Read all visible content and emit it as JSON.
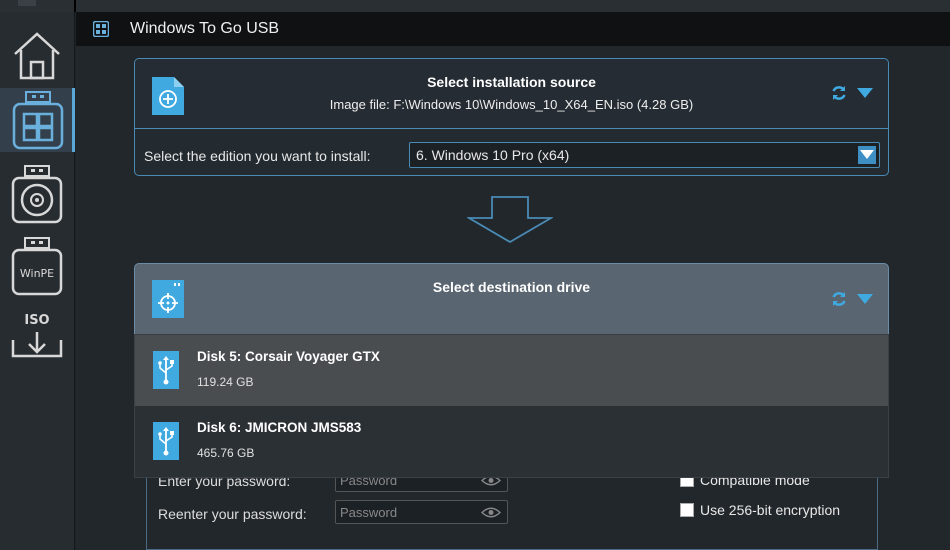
{
  "window": {
    "title": "Windows To Go USB"
  },
  "sidebar": {
    "items": [
      {
        "name": "home",
        "label": ""
      },
      {
        "name": "windows-to-go",
        "label": ""
      },
      {
        "name": "disc",
        "label": ""
      },
      {
        "name": "winpe",
        "label": "WinPE"
      },
      {
        "name": "iso",
        "label": "ISO"
      }
    ]
  },
  "source": {
    "title": "Select installation source",
    "image_file": "Image file: F:\\Windows 10\\Windows_10_X64_EN.iso (4.28 GB)",
    "edition_label": "Select the edition you want to install:",
    "edition_value": "6. Windows 10 Pro (x64)"
  },
  "destination": {
    "title": "Select destination drive",
    "drives": [
      {
        "name": "Disk 5: Corsair Voyager GTX",
        "size": "119.24 GB"
      },
      {
        "name": "Disk 6: JMICRON JMS583",
        "size": "465.76 GB"
      }
    ]
  },
  "form": {
    "enter_password_label": "Enter your password:",
    "reenter_password_label": "Reenter your password:",
    "password_placeholder": "Password",
    "compatible_mode_label": "Compatible mode",
    "encryption_label": "Use 256-bit encryption"
  },
  "colors": {
    "accent": "#3fa9e0",
    "background": "#22272c",
    "selected_row": "#4a4d50"
  }
}
